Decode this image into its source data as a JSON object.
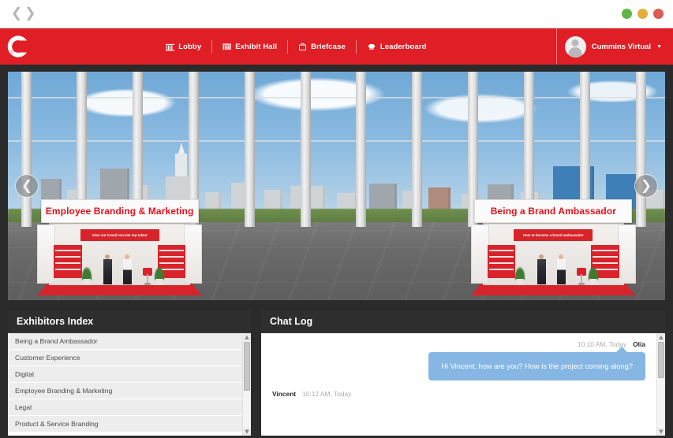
{
  "browser": {
    "back_icon": "chevron-left-icon",
    "forward_icon": "chevron-right-icon",
    "window_controls": [
      {
        "name": "minimize",
        "color": "#63b34b"
      },
      {
        "name": "maximize",
        "color": "#e3ae3c"
      },
      {
        "name": "close",
        "color": "#dd5b50"
      }
    ]
  },
  "header": {
    "brand_color": "#e01e26",
    "logo": "cummins-logo",
    "nav": [
      {
        "label": "Lobby",
        "icon": "building-columns-icon"
      },
      {
        "label": "Exhibit Hall",
        "icon": "exhibit-hall-icon"
      },
      {
        "label": "Briefcase",
        "icon": "briefcase-icon"
      },
      {
        "label": "Leaderboard",
        "icon": "leaderboard-icon"
      }
    ],
    "user": {
      "name": "Cummins Virtual",
      "avatar_icon": "user-avatar-icon",
      "caret_icon": "chevron-down-icon"
    }
  },
  "stage": {
    "prev_label": "❮",
    "next_label": "❯",
    "scene": "Indianapolis skyline exhibit hall",
    "booths": [
      {
        "title": "Employee Branding & Marketing",
        "banner": "View our brand recruits top talent",
        "panel_left_lines": "Chat Timings\nJohn Smith\nContact: 9:00-9pm (EST)\n\nMike Jones\nContact: 2:00-10pm (EST)",
        "panel_right_lines": "Watch the branding refresh video\nView the list of products\nChat with Cindy to get the next steps"
      },
      {
        "title": "Being a Brand Ambassador",
        "banner": "How to become a brand ambassador",
        "panel_left_lines": "Chat Timings\nJohn Smith\nContact: 9:00-9pm (EST)\n\nMike Jones\nContact: 2:00-10pm (EST)",
        "panel_right_lines": "Watch the branding refresh video\nView the list of products\nChat with Cindy to get the next steps"
      }
    ]
  },
  "exhibitors": {
    "title": "Exhibitors Index",
    "items": [
      {
        "label": "Being a Brand Ambassador"
      },
      {
        "label": "Customer Experience"
      },
      {
        "label": "Digital"
      },
      {
        "label": "Employee Branding & Marketing"
      },
      {
        "label": "Legal"
      },
      {
        "label": "Product & Service Branding"
      }
    ],
    "scrollbar": {
      "up_icon": "▲",
      "down_icon": "▼"
    }
  },
  "chat": {
    "title": "Chat Log",
    "messages": [
      {
        "author": "Olia",
        "time": "10:10 AM, Today",
        "text": "Hi Vincent, how are you? How is the project coming along?",
        "side": "right"
      },
      {
        "author": "Vincent",
        "time": "10:12 AM, Today",
        "text": "",
        "side": "left"
      }
    ],
    "scrollbar": {
      "up_icon": "▲",
      "down_icon": "▼"
    }
  }
}
